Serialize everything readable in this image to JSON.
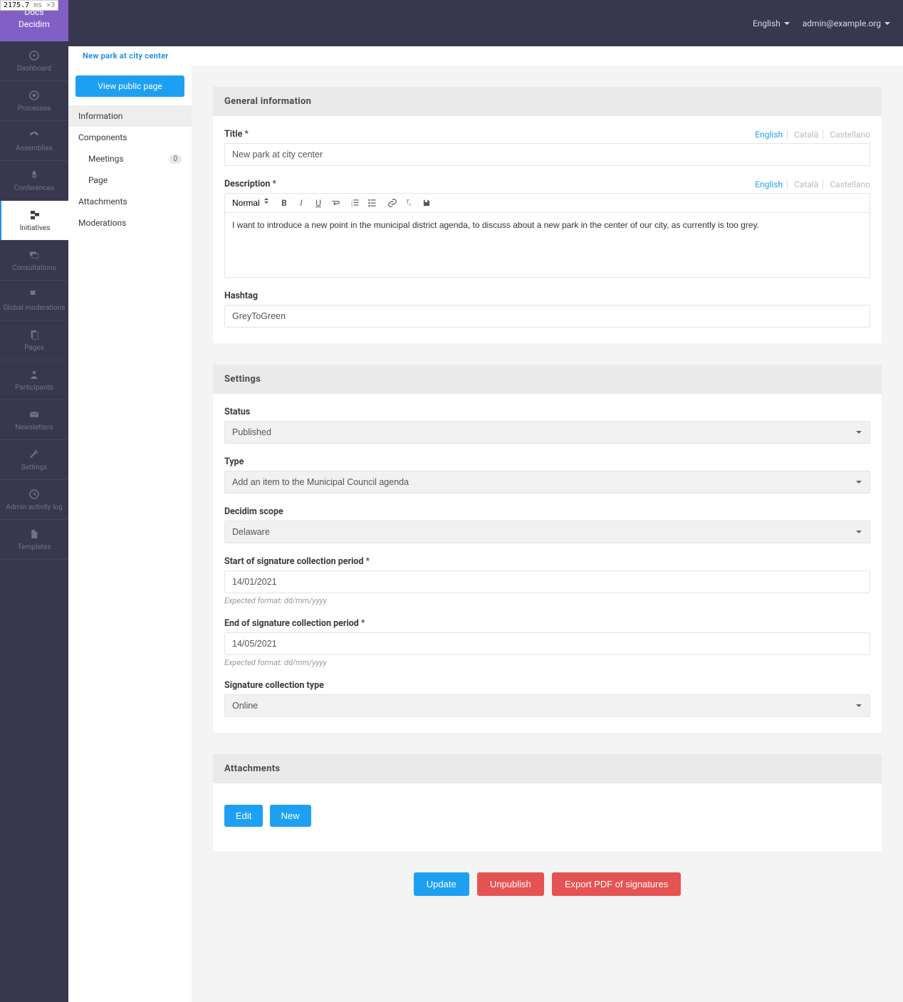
{
  "perf_badge": {
    "time": "2175.7",
    "unit": "ms",
    "mult": "×3"
  },
  "brand": {
    "line1": "Docs",
    "line2": "Decidim"
  },
  "main_nav": {
    "items": [
      {
        "label": "Dashboard"
      },
      {
        "label": "Processes"
      },
      {
        "label": "Assemblies"
      },
      {
        "label": "Conferences"
      },
      {
        "label": "Initiatives"
      },
      {
        "label": "Consultations"
      },
      {
        "label": "Global moderations"
      },
      {
        "label": "Pages"
      },
      {
        "label": "Participants"
      },
      {
        "label": "Newsletters"
      },
      {
        "label": "Settings"
      },
      {
        "label": "Admin activity log"
      },
      {
        "label": "Templates"
      }
    ]
  },
  "topbar": {
    "language": "English",
    "user": "admin@example.org"
  },
  "breadcrumb": "New park at city center",
  "sub_nav": {
    "view_public": "View public page",
    "information": "Information",
    "components": "Components",
    "meetings": {
      "label": "Meetings",
      "count": "0"
    },
    "page": "Page",
    "attachments": "Attachments",
    "moderations": "Moderations"
  },
  "sections": {
    "general": {
      "header": "General information",
      "title_label": "Title",
      "title_value": "New park at city center",
      "desc_label": "Description",
      "desc_value": "I want to introduce a new point in the municipal district agenda, to discuss about a new park in the center of our city, as currently is too grey.",
      "hashtag_label": "Hashtag",
      "hashtag_value": "GreyToGreen"
    },
    "settings": {
      "header": "Settings",
      "status_label": "Status",
      "status_value": "Published",
      "type_label": "Type",
      "type_value": "Add an item to the Municipal Council agenda",
      "scope_label": "Decidim scope",
      "scope_value": "Delaware",
      "start_label": "Start of signature collection period",
      "start_value": "14/01/2021",
      "end_label": "End of signature collection period",
      "end_value": "14/05/2021",
      "expected_format": "Expected format: dd/mm/yyyy",
      "sig_type_label": "Signature collection type",
      "sig_type_value": "Online"
    },
    "attachments": {
      "header": "Attachments",
      "edit": "Edit",
      "new": "New"
    }
  },
  "lang_tabs": {
    "english": "English",
    "catala": "Català",
    "castellano": "Castellano"
  },
  "editor": {
    "heading": "Normal"
  },
  "bottom_actions": {
    "update": "Update",
    "unpublish": "Unpublish",
    "export": "Export PDF of signatures"
  }
}
